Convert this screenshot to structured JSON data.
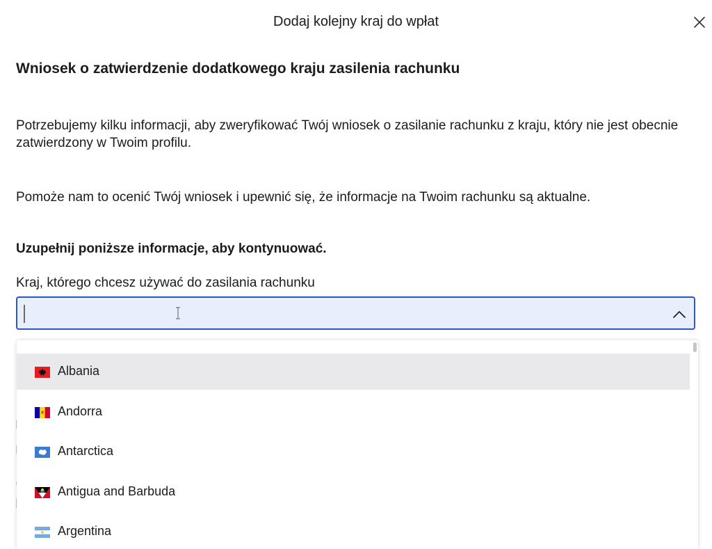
{
  "modal": {
    "title": "Dodaj kolejny kraj do wpłat",
    "close_icon": "close-icon"
  },
  "content": {
    "heading": "Wniosek o zatwierdzenie dodatkowego kraju zasilenia rachunku",
    "paragraph_1": "Potrzebujemy kilku informacji, aby zweryfikować Twój wniosek o zasilanie rachunku z kraju, który nie jest obecnie zatwierdzony w Twoim profilu.",
    "paragraph_2": "Pomoże nam to ocenić Twój wniosek i upewnić się, że informacje na Twoim rachunku są aktualne.",
    "subheading": "Uzupełnij poniższe informacje, aby kontynuować.",
    "country_field": {
      "label": "Kraj, którego chcesz używać do zasilania rachunku",
      "value": "",
      "placeholder": "",
      "toggle_icon": "chevron-up-icon"
    }
  },
  "dropdown": {
    "options": [
      {
        "label": "Albania",
        "flag": "albania-flag-icon",
        "highlighted": true
      },
      {
        "label": "Andorra",
        "flag": "andorra-flag-icon",
        "highlighted": false
      },
      {
        "label": "Antarctica",
        "flag": "antarctica-flag-icon",
        "highlighted": false
      },
      {
        "label": "Antigua and Barbuda",
        "flag": "antigua-flag-icon",
        "highlighted": false
      },
      {
        "label": "Argentina",
        "flag": "argentina-flag-icon",
        "highlighted": false
      }
    ]
  },
  "colors": {
    "focus_border": "#2d55c4",
    "input_background": "#e8eefb",
    "highlight_row": "#e9e9eb"
  }
}
